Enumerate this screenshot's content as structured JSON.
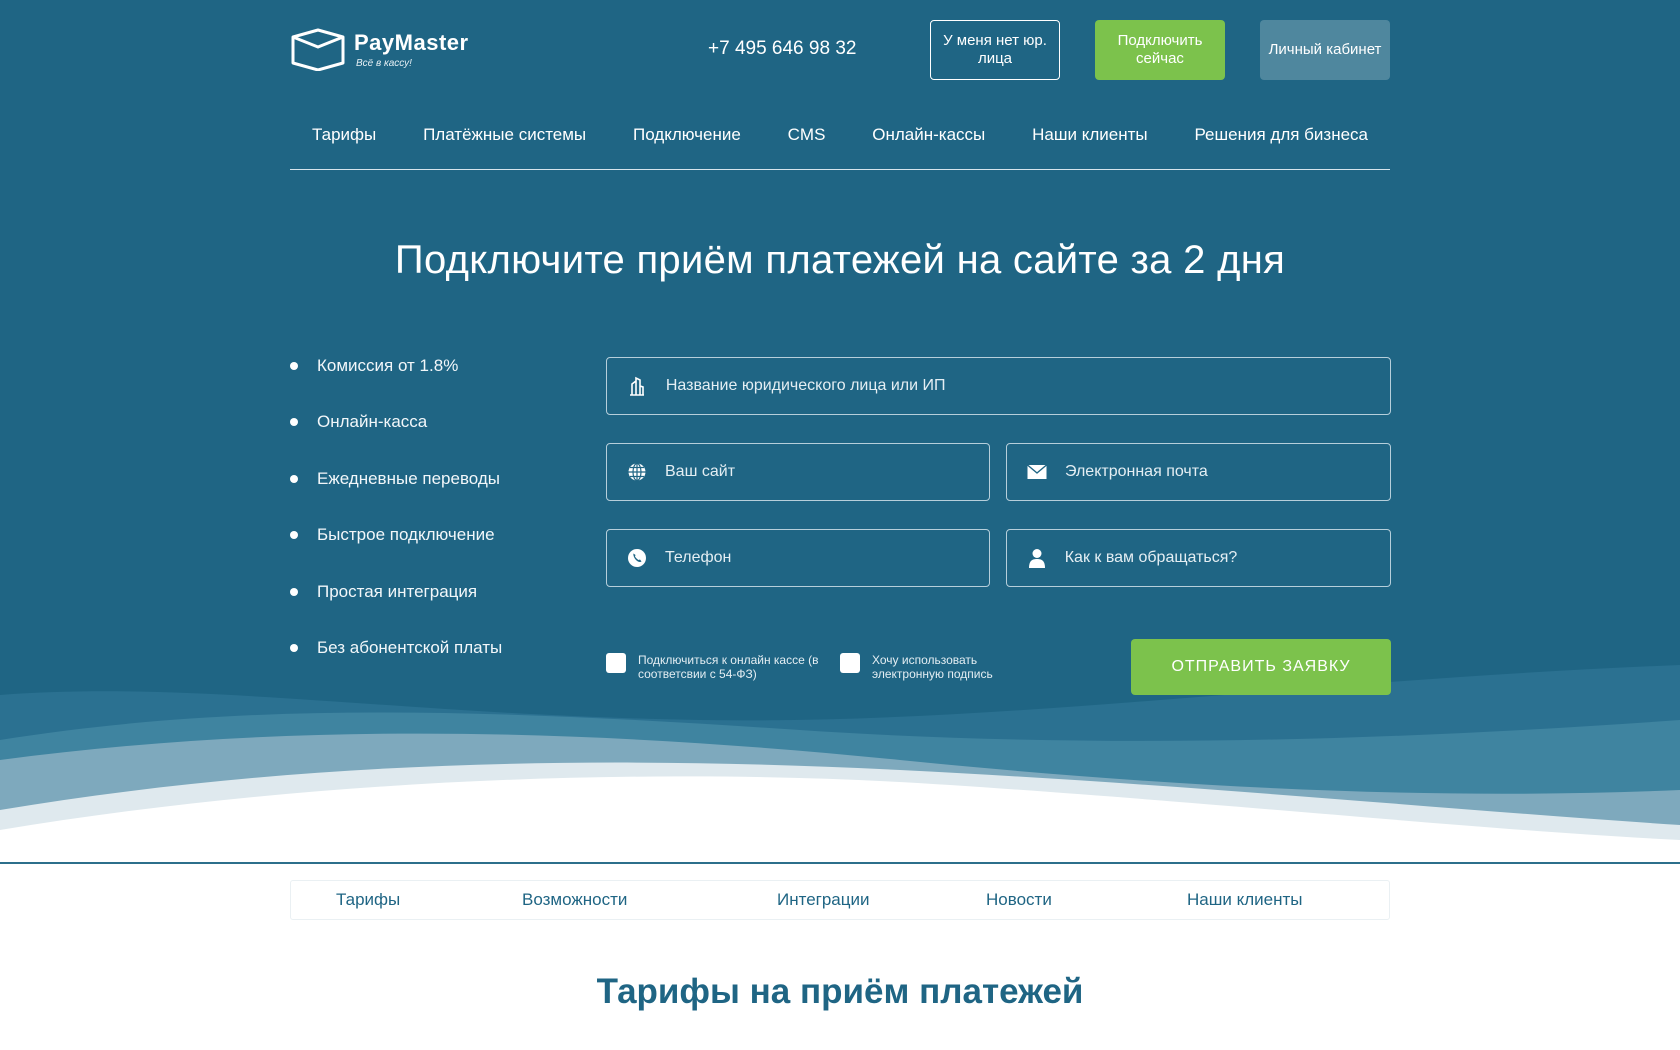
{
  "brand": {
    "name": "PayMaster",
    "slogan": "Всё в кассу!"
  },
  "header": {
    "phone": "+7 495 646 98 32",
    "no_legal_entity_label": "У меня нет юр. лица",
    "connect_now_label": "Подключить сейчас",
    "account_label": "Личный кабинет"
  },
  "nav": {
    "items": [
      {
        "label": "Тарифы"
      },
      {
        "label": "Платёжные системы"
      },
      {
        "label": "Подключение"
      },
      {
        "label": "CMS"
      },
      {
        "label": "Онлайн-кассы"
      },
      {
        "label": "Наши клиенты"
      },
      {
        "label": "Решения для бизнеса"
      }
    ]
  },
  "hero": {
    "title": "Подключите приём платежей на сайте за 2 дня",
    "features": [
      "Комиссия от 1.8%",
      "Онлайн-касса",
      "Ежедневные переводы",
      "Быстрое подключение",
      "Простая интеграция",
      "Без абонентской платы"
    ]
  },
  "form": {
    "company": {
      "placeholder": "Название юридического лица или ИП",
      "icon": "building-icon",
      "value": ""
    },
    "site": {
      "placeholder": "Ваш сайт",
      "icon": "globe-icon",
      "value": ""
    },
    "email": {
      "placeholder": "Электронная почта",
      "icon": "envelope-icon",
      "value": ""
    },
    "phone": {
      "placeholder": "Телефон",
      "icon": "phone-icon",
      "value": ""
    },
    "name": {
      "placeholder": "Как к вам обращаться?",
      "icon": "user-icon",
      "value": ""
    },
    "checkbox_online_kassa": "Подключиться к онлайн кассе (в соответсвии с 54-ФЗ)",
    "checkbox_esign": "Хочу использовать электронную подпись",
    "submit_label": "ОТПРАВИТЬ ЗАЯВКУ"
  },
  "subtabs": {
    "items": [
      {
        "label": "Тарифы"
      },
      {
        "label": "Возможности"
      },
      {
        "label": "Интеграции"
      },
      {
        "label": "Новости"
      },
      {
        "label": "Наши клиенты"
      }
    ]
  },
  "section": {
    "title": "Тарифы на приём платежей"
  },
  "colors": {
    "hero_bg": "#1f6584",
    "accent_green": "#7cc24c",
    "account_btn": "#4f879e",
    "link_blue": "#1f6584"
  }
}
